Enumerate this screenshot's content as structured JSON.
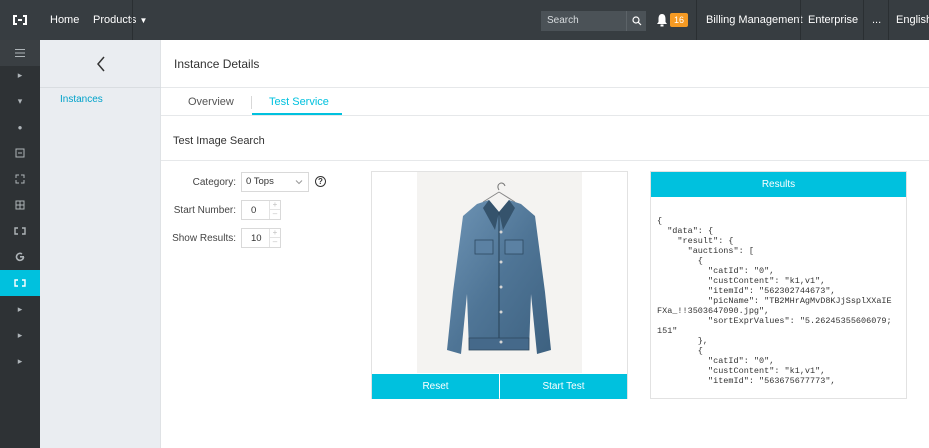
{
  "topbar": {
    "logo": "C      ",
    "home": "Home",
    "products": "Products",
    "search_placeholder": "Search",
    "notification_count": "16",
    "billing": "Billing Management",
    "enterprise": "Enterprise",
    "more": "...",
    "language": "English"
  },
  "subnav": {
    "instances": "Instances"
  },
  "page": {
    "breadcrumb": "Instance Details",
    "tabs": [
      "Overview",
      "Test Service"
    ],
    "section_title": "Test Image Search"
  },
  "form": {
    "category_label": "Category:",
    "category_value": "0 Tops",
    "start_label": "Start Number:",
    "start_value": "0",
    "show_label": "Show Results:",
    "show_value": "10"
  },
  "image_panel": {
    "reset_label": "Reset",
    "start_label": "Start Test"
  },
  "results": {
    "title": "Results",
    "json_text": "{\n  \"data\": {\n    \"result\": {\n      \"auctions\": [\n        {\n          \"catId\": \"0\",\n          \"custContent\": \"k1,v1\",\n          \"itemId\": \"562302744673\",\n          \"picName\": \"TB2MHrAgMvD8KJjSsplXXaIE\nFXa_!!3503647090.jpg\",\n          \"sortExprValues\": \"5.26245355606079;\n151\"\n        },\n        {\n          \"catId\": \"0\",\n          \"custContent\": \"k1,v1\",\n          \"itemId\": \"563675677773\","
  },
  "colors": {
    "accent": "#00c1de",
    "topbar": "#373d41",
    "badge": "#f59a23"
  }
}
